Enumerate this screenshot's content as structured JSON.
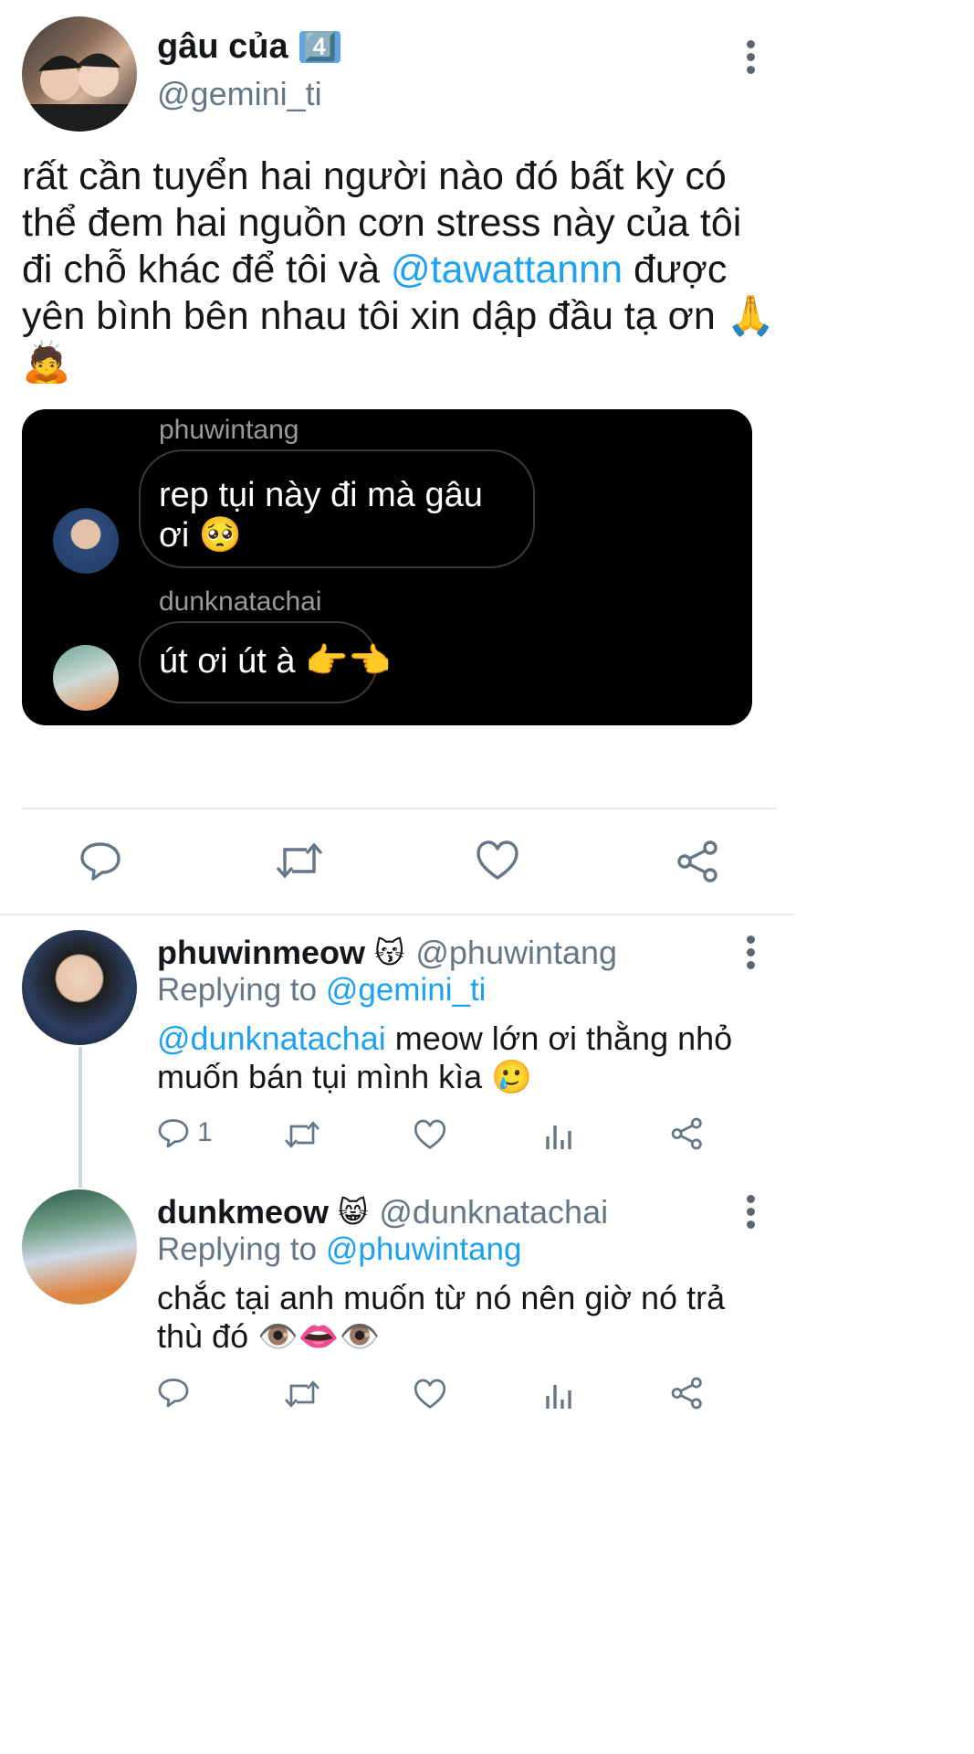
{
  "main_tweet": {
    "display_name": "gâu của",
    "name_badge": "4️⃣",
    "handle": "@gemini_ti",
    "text_before_mention": "rất cần tuyển hai người nào đó bất kỳ có thể đem hai nguồn cơn stress này của tôi đi chỗ khác để tôi và",
    "mention": "@tawattannn",
    "text_after_mention": "được yên bình bên nhau tôi xin dập đầu tạ ơn 🙏🙇"
  },
  "dm_card": {
    "messages": [
      {
        "sender": "phuwintang",
        "text": "rep tụi này đi mà gâu ơi 🥺"
      },
      {
        "sender": "dunknatachai",
        "text": "út ơi út à 👉👈"
      }
    ]
  },
  "reply_1": {
    "display_name": "phuwinmeow",
    "name_emoji": "😽",
    "handle": "@phuwintang",
    "replying_label": "Replying to",
    "replying_to": "@gemini_ti",
    "mention": "@dunknatachai",
    "text": "meow lớn ơi thằng nhỏ muốn bán tụi mình kìa 🥲",
    "reply_count": "1"
  },
  "reply_2": {
    "display_name": "dunkmeow",
    "name_emoji": "😸",
    "handle": "@dunknatachai",
    "replying_label": "Replying to",
    "replying_to": "@phuwintang",
    "text": "chắc tại anh muốn từ nó nên giờ nó trả thù đó 👁️👄👁️"
  },
  "colors": {
    "link": "#1da1f2",
    "muted": "#657786",
    "card_bg": "#000000"
  },
  "icons": [
    "more-vertical-icon",
    "reply-icon",
    "retweet-icon",
    "like-icon",
    "analytics-icon",
    "share-icon"
  ]
}
